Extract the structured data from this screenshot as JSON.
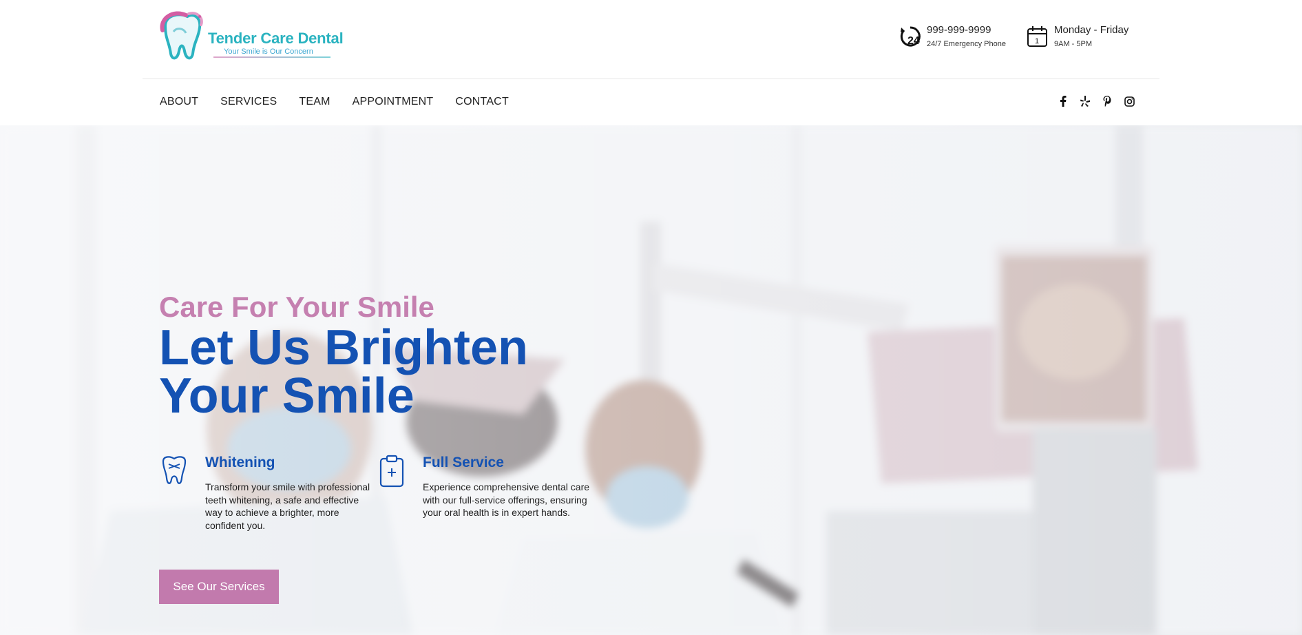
{
  "brand": {
    "name": "Tender Care Dental",
    "tagline": "Your Smile is Our Concern"
  },
  "contact": {
    "phone": "999-999-9999",
    "phone_note": "24/7 Emergency Phone",
    "days": "Monday - Friday",
    "hours": "9AM - 5PM",
    "calendar_day": "1"
  },
  "nav": {
    "items": [
      {
        "label": "ABOUT"
      },
      {
        "label": "SERVICES"
      },
      {
        "label": "TEAM"
      },
      {
        "label": "APPOINTMENT"
      },
      {
        "label": "CONTACT"
      }
    ]
  },
  "socials": [
    "facebook-icon",
    "yelp-icon",
    "pinterest-icon",
    "instagram-icon"
  ],
  "hero": {
    "kicker": "Care For Your Smile",
    "headline": "Let Us Brighten Your Smile",
    "features": [
      {
        "icon": "tooth-icon",
        "title": "Whitening",
        "description": "Transform your smile with professional teeth whitening, a safe and effective way to achieve a brighter, more confident you."
      },
      {
        "icon": "medical-clipboard-icon",
        "title": "Full Service",
        "description": "Experience comprehensive dental care with our full-service offerings, ensuring your oral health is in expert hands."
      }
    ],
    "cta_label": "See Our Services"
  },
  "colors": {
    "brand_teal": "#2bb3c0",
    "brand_pink": "#c580b0",
    "headline_blue": "#1452b3",
    "button_bg": "#c27aad"
  }
}
